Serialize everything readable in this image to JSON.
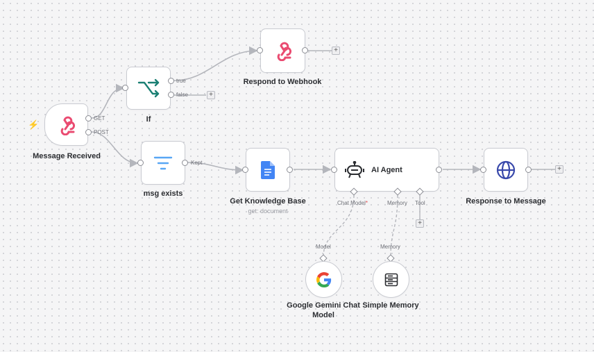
{
  "nodes": {
    "message_received": {
      "label": "Message Received",
      "icon": "webhook-icon",
      "trigger_icon": "⚡"
    },
    "if": {
      "label": "If",
      "icon": "branch-icon"
    },
    "respond_webhook": {
      "label": "Respond to Webhook",
      "icon": "webhook-icon"
    },
    "msg_exists": {
      "label": "msg exists",
      "icon": "filter-icon"
    },
    "get_kb": {
      "label": "Get Knowledge Base",
      "sublabel": "get: document",
      "icon": "google-docs-icon"
    },
    "ai_agent": {
      "label": "AI Agent",
      "icon": "robot-icon"
    },
    "response_message": {
      "label": "Response to Message",
      "icon": "globe-icon"
    },
    "gemini": {
      "label_line1": "Google Gemini Chat",
      "label_line2": "Model",
      "icon": "google-icon"
    },
    "simple_memory": {
      "label": "Simple Memory",
      "icon": "database-icon"
    }
  },
  "ports": {
    "get": "GET",
    "post": "POST",
    "true": "true",
    "false": "false",
    "kept": "Kept",
    "chat_model": "Chat Model",
    "chat_model_required": "*",
    "memory": "Memory",
    "tool": "Tool",
    "model_in": "Model",
    "memory_in": "Memory"
  },
  "plus": "+",
  "colors": {
    "accent": "#ea4b71",
    "canvas": "#f5f5f6",
    "wire": "#b4b6bc",
    "teal": "#1a7f73",
    "blue": "#3949ab",
    "docs_blue": "#4285f4"
  }
}
